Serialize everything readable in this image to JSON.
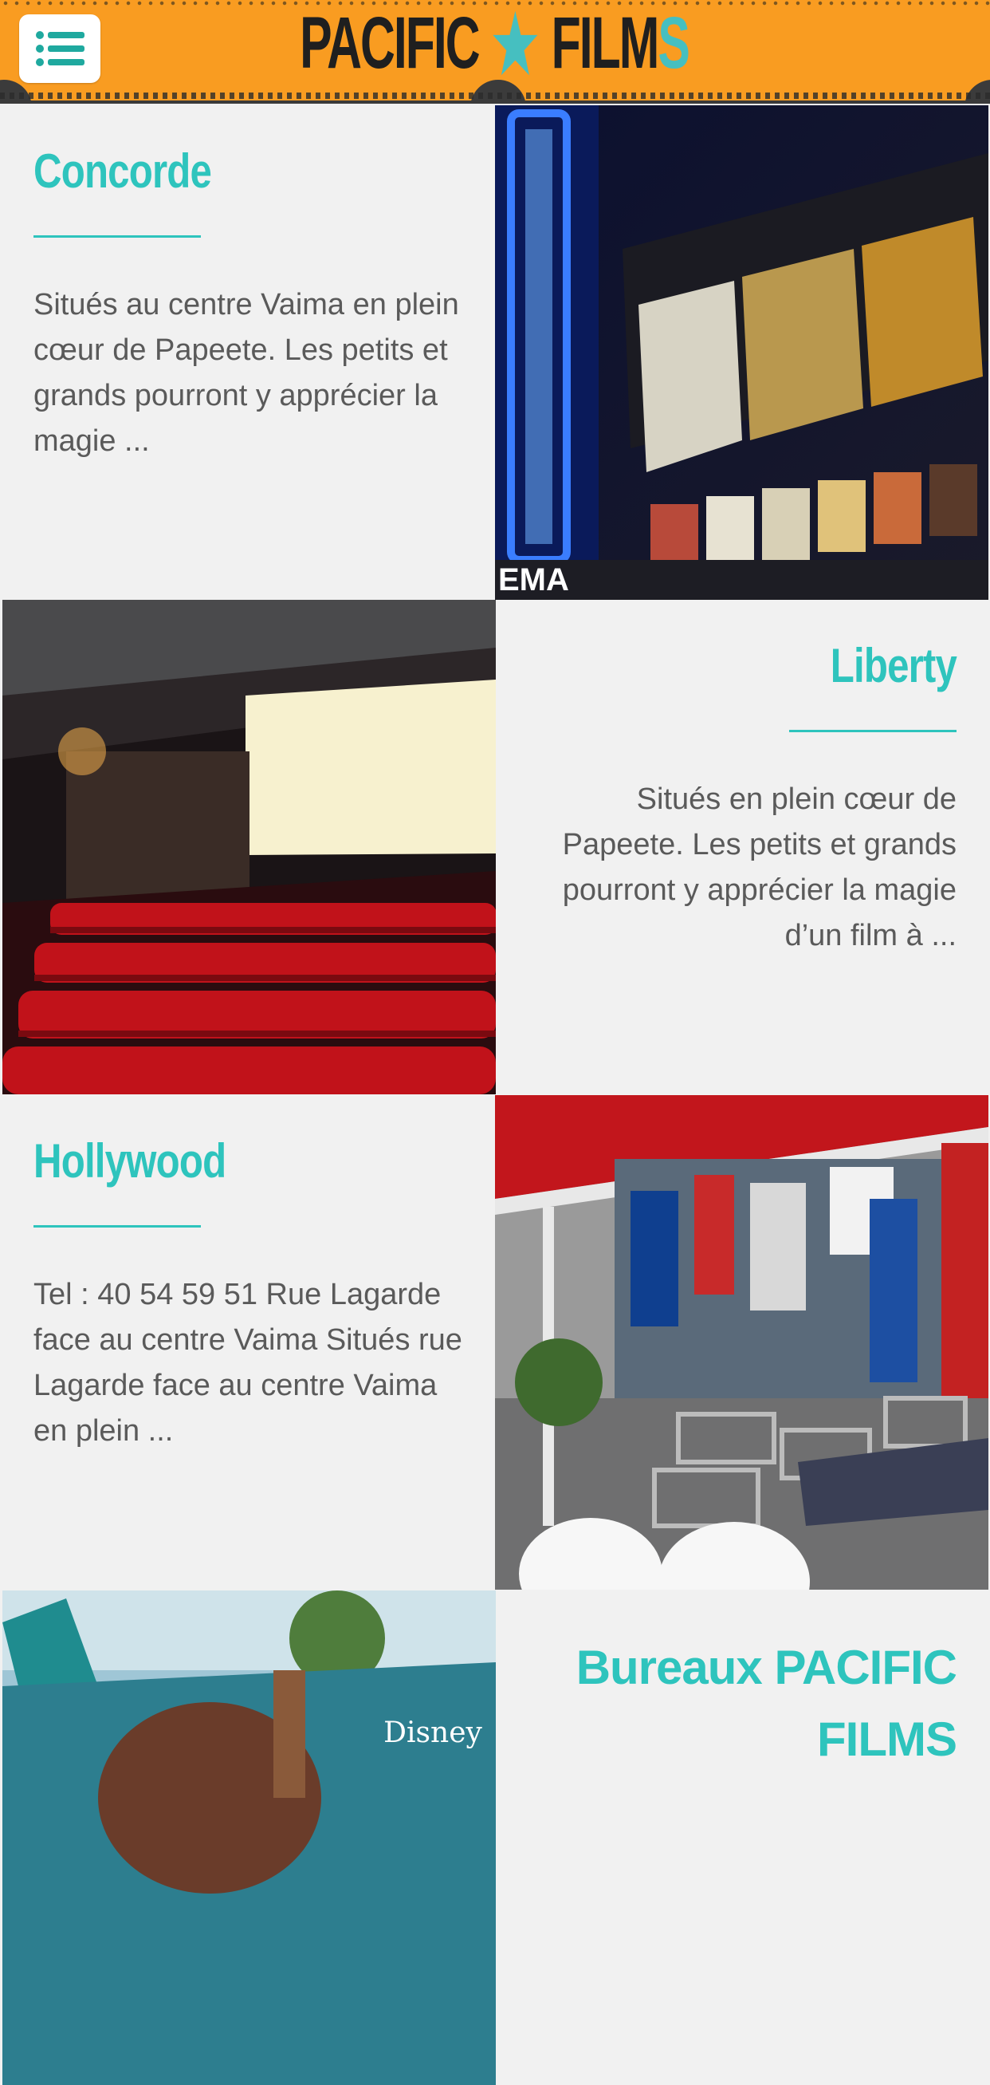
{
  "header": {
    "menu_icon": "list-icon",
    "brand_left": "PACIFIC",
    "brand_right": "FILM",
    "brand_tail": "S",
    "colors": {
      "bar": "#f99c21",
      "accent": "#2ec4bd"
    }
  },
  "cinemas": [
    {
      "title": "Concorde",
      "description": "Situés au centre Vaima en plein cœur de Papeete. Les petits et grands pourront y apprécier la magie ...",
      "image": "concorde-cinema-entrance-photo"
    },
    {
      "title": "Liberty",
      "description": "Situés en plein cœur de Papeete. Les petits et grands pourront y apprécier la magie d’un film à ...",
      "image": "liberty-cinema-hall-photo"
    },
    {
      "title": "Hollywood",
      "description": "Tel : 40 54 59 51 Rue Lagarde face au centre Vaima Situés rue Lagarde face au centre Vaima en plein ...",
      "image": "hollywood-cinema-terrace-photo"
    },
    {
      "title": "Bureaux PACIFIC FILMS",
      "image": "pacific-films-office-poster"
    }
  ]
}
